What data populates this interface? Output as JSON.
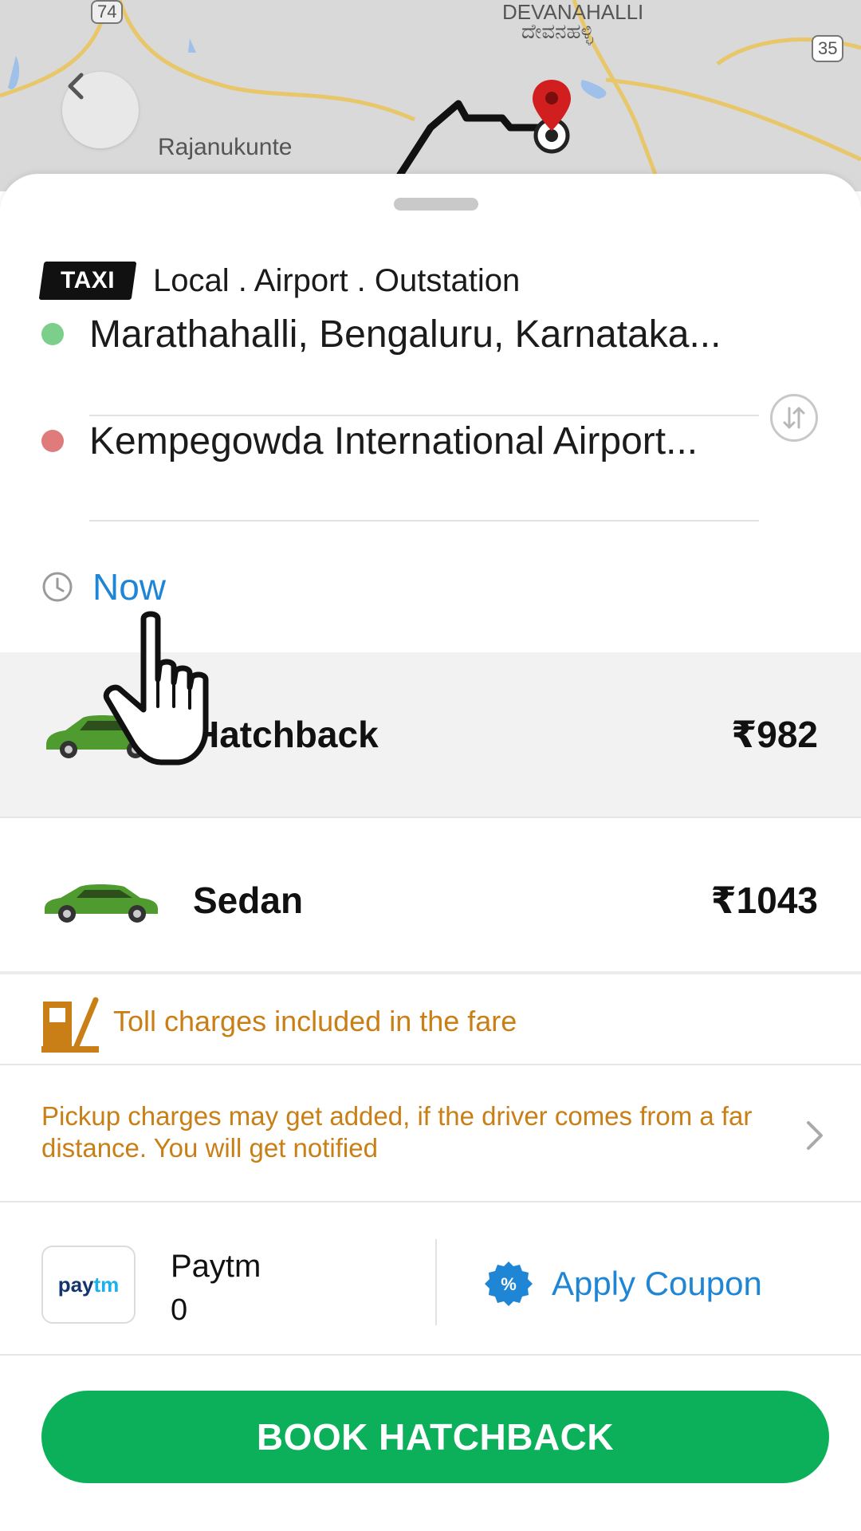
{
  "map": {
    "labels": {
      "devanahalli": "DEVANAHALLI",
      "devanahalli_kn": "ದೇವನಹಳ್ಳಿ",
      "rajanukunte": "Rajanukunte",
      "road_74": "74",
      "road_35": "35"
    },
    "back_icon": "chevron-left-icon",
    "pin_icon": "location-pin-icon"
  },
  "header": {
    "badge": "TAXI",
    "services": "Local . Airport . Outstation"
  },
  "route": {
    "pickup": "Marathahalli, Bengaluru, Karnataka...",
    "drop": "Kempegowda International Airport...",
    "pickup_color": "#7ccf8a",
    "drop_color": "#e07b7b"
  },
  "time": {
    "label": "Now"
  },
  "cars": [
    {
      "name": "Hatchback",
      "price": "₹982",
      "selected": true
    },
    {
      "name": "Sedan",
      "price": "₹1043",
      "selected": false
    }
  ],
  "notices": {
    "toll": "Toll charges included in the fare",
    "pickup": "Pickup charges may get added, if the driver comes from a far distance. You will get notified"
  },
  "payment": {
    "logo_part1": "pay",
    "logo_part2": "tm",
    "name": "Paytm",
    "balance": "0",
    "coupon_badge": "%",
    "coupon_label": "Apply Coupon"
  },
  "cta": {
    "label": "BOOK HATCHBACK"
  },
  "colors": {
    "accent_green": "#0db05a",
    "link_blue": "#1f86d6",
    "notice_orange": "#c97f15"
  }
}
